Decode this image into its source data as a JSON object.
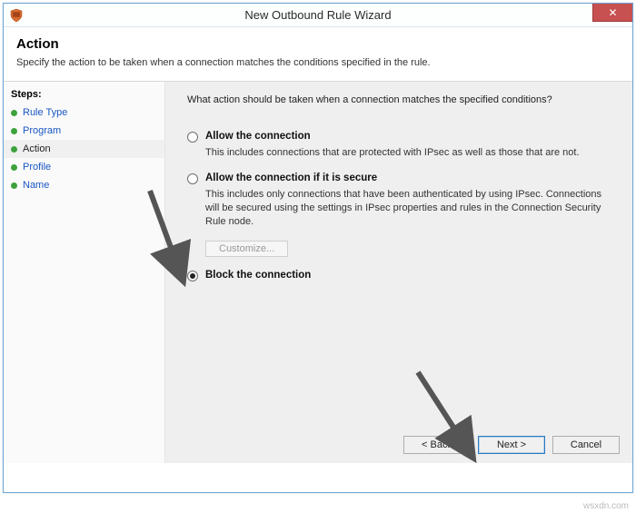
{
  "window": {
    "title": "New Outbound Rule Wizard",
    "close_label": "✕"
  },
  "header": {
    "title": "Action",
    "subtitle": "Specify the action to be taken when a connection matches the conditions specified in the rule."
  },
  "sidebar": {
    "heading": "Steps:",
    "items": [
      {
        "label": "Rule Type",
        "active": false
      },
      {
        "label": "Program",
        "active": false
      },
      {
        "label": "Action",
        "active": true
      },
      {
        "label": "Profile",
        "active": false
      },
      {
        "label": "Name",
        "active": false
      }
    ]
  },
  "main": {
    "question": "What action should be taken when a connection matches the specified conditions?",
    "options": [
      {
        "title": "Allow the connection",
        "desc": "This includes connections that are protected with IPsec as well as those that are not.",
        "selected": false
      },
      {
        "title": "Allow the connection if it is secure",
        "desc": "This includes only connections that have been authenticated by using IPsec. Connections will be secured using the settings in IPsec properties and rules in the Connection Security Rule node.",
        "selected": false
      },
      {
        "title": "Block the connection",
        "desc": "",
        "selected": true
      }
    ],
    "customize_label": "Customize..."
  },
  "buttons": {
    "back": "< Back",
    "next": "Next >",
    "cancel": "Cancel"
  },
  "watermark": "wsxdn.com"
}
